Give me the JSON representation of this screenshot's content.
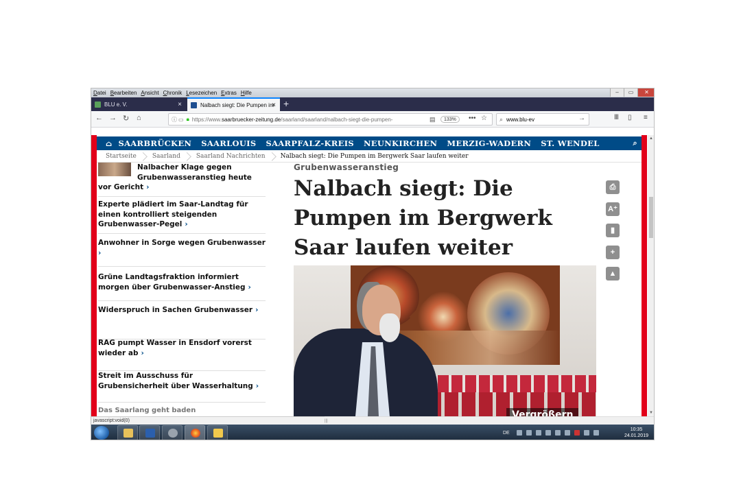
{
  "menubar": {
    "items": [
      "Datei",
      "Bearbeiten",
      "Ansicht",
      "Chronik",
      "Lesezeichen",
      "Extras",
      "Hilfe"
    ]
  },
  "tabs": [
    {
      "label": "BLU e. V."
    },
    {
      "label": "Nalbach siegt: Die Pumpen im"
    }
  ],
  "navbar": {
    "url_host_prefix": "https://www.",
    "url_host": "saarbruecker-zeitung.de",
    "url_path": "/saarland/saarland/nalbach-siegt-die-pumpen-",
    "zoom": "133%",
    "search_value": "www.blu-ev"
  },
  "site_nav": {
    "items": [
      "SAARBRÜCKEN",
      "SAARLOUIS",
      "SAARPFALZ-KREIS",
      "NEUNKIRCHEN",
      "MERZIG-WADERN",
      "ST. WENDEL"
    ]
  },
  "breadcrumb": {
    "items": [
      "Startseite",
      "Saarland",
      "Saarland Nachrichten"
    ],
    "current": "Nalbach siegt: Die Pumpen im Bergwerk Saar laufen weiter"
  },
  "sidebar": {
    "items": [
      {
        "text_a": "Nalbacher Klage gegen",
        "text_b": "Grubenwasseranstieg heute",
        "text_c": "vor Gericht"
      },
      {
        "text": "Experte plädiert im Saar-Landtag für einen kontrolliert steigenden Grubenwasser-Pegel"
      },
      {
        "text": "Anwohner in Sorge wegen Grubenwasser"
      },
      {
        "text": "Grüne Landtagsfraktion informiert morgen über Grubenwasser-Anstieg"
      },
      {
        "text": "Widerspruch in Sachen Grubenwasser"
      },
      {
        "text": "RAG pumpt Wasser in Ensdorf vorerst wieder ab"
      },
      {
        "text": "Streit im Ausschuss für Grubensicherheit über Wasserhaltung"
      }
    ],
    "teaser": "Das Saarlang geht baden"
  },
  "article": {
    "kicker": "Grubenwasseranstieg",
    "headline": "Nalbach siegt: Die Pumpen im Bergwerk Saar laufen weiter",
    "enlarge_label": "Vergrößern"
  },
  "statusbar": {
    "text": "javascript:void(0)"
  },
  "taskbar": {
    "lang": "DE",
    "time": "10:35",
    "date": "24.01.2019"
  },
  "colors": {
    "brand_blue": "#004b87",
    "brand_red": "#e2001a",
    "tab_bar": "#2b2d4a"
  }
}
